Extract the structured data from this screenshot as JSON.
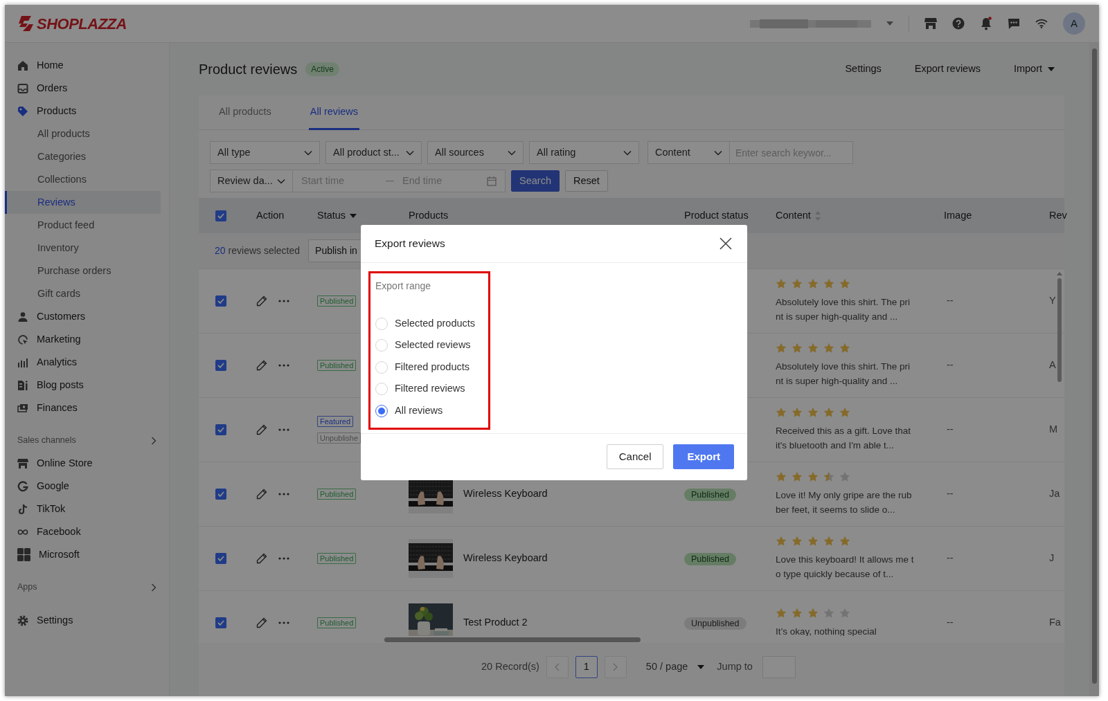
{
  "topbar": {
    "logo": "SHOPLAZZA",
    "avatar": "A"
  },
  "sidebar": {
    "groups": [
      {
        "items": [
          {
            "label": "Home",
            "active": false
          },
          {
            "label": "Orders",
            "active": false
          },
          {
            "label": "Products",
            "active": true,
            "children": [
              {
                "label": "All products",
                "selected": false
              },
              {
                "label": "Categories",
                "selected": false
              },
              {
                "label": "Collections",
                "selected": false
              },
              {
                "label": "Reviews",
                "selected": true
              },
              {
                "label": "Product feed",
                "selected": false
              },
              {
                "label": "Inventory",
                "selected": false
              },
              {
                "label": "Purchase orders",
                "selected": false
              },
              {
                "label": "Gift cards",
                "selected": false
              }
            ]
          },
          {
            "label": "Customers",
            "active": false
          },
          {
            "label": "Marketing",
            "active": false
          },
          {
            "label": "Analytics",
            "active": false
          },
          {
            "label": "Blog posts",
            "active": false
          },
          {
            "label": "Finances",
            "active": false
          }
        ]
      },
      {
        "heading": "Sales channels",
        "items": [
          {
            "label": "Online Store",
            "active": false
          },
          {
            "label": "Google",
            "active": false
          },
          {
            "label": "TikTok",
            "active": false
          },
          {
            "label": "Facebook",
            "active": false
          },
          {
            "label": "Microsoft",
            "active": false
          }
        ]
      },
      {
        "heading": "Apps"
      }
    ],
    "footer_item": {
      "label": "Settings",
      "active": false
    }
  },
  "page": {
    "title": "Product reviews",
    "badge": "Active",
    "actions": [
      {
        "label": "Settings",
        "kind": "link"
      },
      {
        "label": "Export reviews",
        "kind": "link"
      },
      {
        "label": "Import",
        "kind": "dropdown"
      }
    ]
  },
  "tabs": [
    {
      "label": "All products",
      "selected": false
    },
    {
      "label": "All reviews",
      "selected": true
    }
  ],
  "filters": {
    "selects": [
      "All type",
      "All product st...",
      "All sources",
      "All rating"
    ],
    "content_select": "Content",
    "keyword": {
      "placeholder": "Enter search keywor..."
    },
    "date_select": "Review da...",
    "start": {
      "placeholder": "Start time"
    },
    "end": {
      "placeholder": "End time"
    },
    "buttons": [
      {
        "label": "Search",
        "kind": "primary"
      },
      {
        "label": "Reset",
        "kind": "default"
      }
    ]
  },
  "table": {
    "all_checked": true,
    "columns": [
      {
        "label": "Action"
      },
      {
        "label": "Status",
        "kind": "filter"
      },
      {
        "label": "Products"
      },
      {
        "label": "Product status"
      },
      {
        "label": "Content",
        "kind": "sort"
      },
      {
        "label": "Image"
      },
      {
        "label": "Rev"
      }
    ],
    "selection": {
      "count": "20",
      "text": "reviews selected",
      "button": "Publish in"
    },
    "rows": [
      {
        "checked": true,
        "tags": [
          {
            "label": "Published",
            "kind": "published"
          }
        ],
        "stars": 5,
        "content": "Absolutely love this shirt. The print is super high-quality and ...",
        "image": "--",
        "reviewer": "Y"
      },
      {
        "checked": true,
        "tags": [
          {
            "label": "Published",
            "kind": "published"
          }
        ],
        "stars": 5,
        "content": "Absolutely love this shirt. The print is super high-quality and ...",
        "image": "--",
        "reviewer": "A"
      },
      {
        "checked": true,
        "tags": [
          {
            "label": "Featured",
            "kind": "featured"
          },
          {
            "label": "Unpublishe",
            "kind": "unpublished"
          }
        ],
        "stars": 5,
        "content": "Received this as a gift. Love that it's bluetooth and I'm able t...",
        "image": "--",
        "reviewer": "M"
      },
      {
        "checked": true,
        "tags": [
          {
            "label": "Published",
            "kind": "published"
          }
        ],
        "product": {
          "name": "Wireless Keyboard"
        },
        "product_status": {
          "label": "Published",
          "kind": "published"
        },
        "stars": 3.5,
        "content": "Love it! My only gripe are the rubber feet, it seems to slide o...",
        "image": "--",
        "reviewer": "Ja"
      },
      {
        "checked": true,
        "tags": [
          {
            "label": "Published",
            "kind": "published"
          }
        ],
        "product": {
          "name": "Wireless Keyboard"
        },
        "product_status": {
          "label": "Published",
          "kind": "published"
        },
        "stars": 5,
        "content": "Love this keyboard! It allows me to type quickly because of t...",
        "image": "--",
        "reviewer": "J"
      },
      {
        "checked": true,
        "tags": [
          {
            "label": "Published",
            "kind": "published"
          }
        ],
        "product": {
          "name": "Test Product 2"
        },
        "product_status": {
          "label": "Unpublished",
          "kind": "unpublished"
        },
        "stars": 3,
        "content": "It’s okay, nothing special",
        "image": "--",
        "reviewer": "Fa"
      }
    ]
  },
  "pagination": {
    "total": "20 Record(s)",
    "pages": [
      {
        "label": "1",
        "selected": true
      }
    ],
    "page_size": "50 / page",
    "jump_label": "Jump to"
  },
  "modal": {
    "title": "Export reviews",
    "section": "Export range",
    "highlighted": true,
    "options": [
      {
        "label": "Selected products",
        "selected": false
      },
      {
        "label": "Selected reviews",
        "selected": false
      },
      {
        "label": "Filtered products",
        "selected": false
      },
      {
        "label": "Filtered reviews",
        "selected": false
      },
      {
        "label": "All reviews",
        "selected": true
      }
    ],
    "buttons": [
      {
        "label": "Cancel",
        "kind": "default"
      },
      {
        "label": "Export",
        "kind": "primary"
      }
    ]
  }
}
